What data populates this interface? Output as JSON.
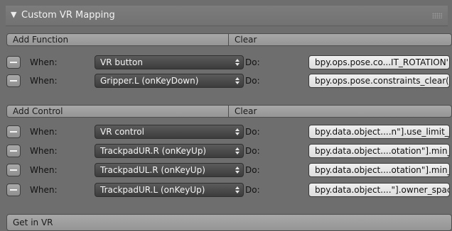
{
  "panel": {
    "title": "Custom VR Mapping"
  },
  "function_section": {
    "add_label": "Add Function",
    "clear_label": "Clear",
    "rows": [
      {
        "when": "When:",
        "select": "VR button",
        "do": "Do:",
        "action": "bpy.ops.pose.co...IT_ROTATION')"
      },
      {
        "when": "When:",
        "select": "Gripper.L (onKeyDown)",
        "do": "Do:",
        "action": "bpy.ops.pose.constraints_clear()"
      }
    ]
  },
  "control_section": {
    "add_label": "Add Control",
    "clear_label": "Clear",
    "rows": [
      {
        "when": "When:",
        "select": "VR control",
        "do": "Do:",
        "action": "bpy.data.object....n\"].use_limit_x"
      },
      {
        "when": "When:",
        "select": "TrackpadUR.R (onKeyUp)",
        "do": "Do:",
        "action": "bpy.data.object....otation\"].min_x"
      },
      {
        "when": "When:",
        "select": "TrackpadUL.R (onKeyUp)",
        "do": "Do:",
        "action": "bpy.data.object....otation\"].min_x"
      },
      {
        "when": "When:",
        "select": "TrackpadUR.L (onKeyUp)",
        "do": "Do:",
        "action": "bpy.data.object....\"].owner_space"
      }
    ]
  },
  "footer": {
    "get_in_vr_label": "Get in VR"
  }
}
